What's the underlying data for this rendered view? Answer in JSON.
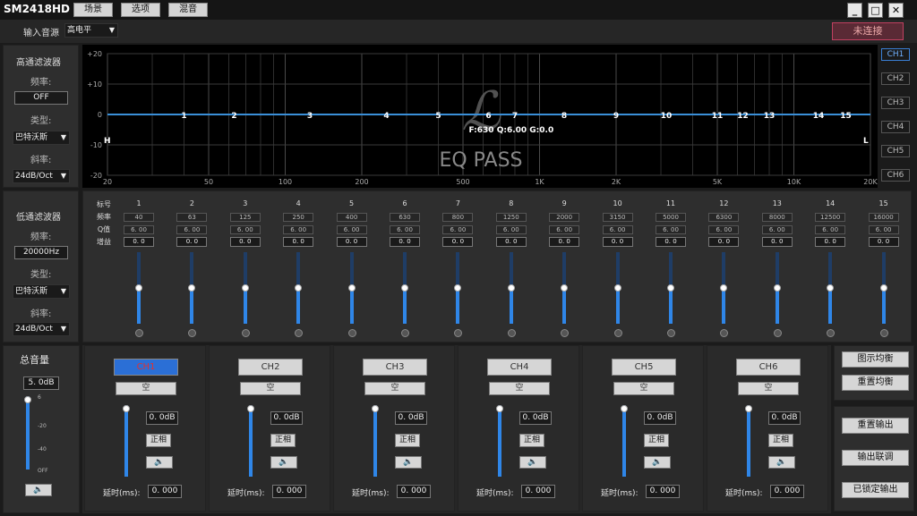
{
  "app": {
    "title": "SM2418HD",
    "menu": [
      "场景",
      "选项",
      "混音"
    ],
    "min_label": "_",
    "max_label": "□",
    "close_label": "✕"
  },
  "toolbar": {
    "input_source_label": "输入音源",
    "input_source_value": "高电平",
    "connect_label": "未连接"
  },
  "highpass": {
    "title": "高通滤波器",
    "freq_label": "频率:",
    "freq_value": "OFF",
    "type_label": "类型:",
    "type_value": "巴特沃斯",
    "slope_label": "斜率:",
    "slope_value": "24dB/Oct"
  },
  "lowpass": {
    "title": "低通滤波器",
    "freq_label": "频率:",
    "freq_value": "20000Hz",
    "type_label": "类型:",
    "type_value": "巴特沃斯",
    "slope_label": "斜率:",
    "slope_value": "24dB/Oct"
  },
  "graph": {
    "y_ticks": [
      "+20",
      "+10",
      "0",
      "-10",
      "-20"
    ],
    "x_ticks": [
      "20",
      "50",
      "100",
      "200",
      "500",
      "1K",
      "2K",
      "5K",
      "10K",
      "20K"
    ],
    "band_markers": [
      "1",
      "2",
      "3",
      "4",
      "5",
      "6",
      "7",
      "8",
      "9",
      "10",
      "11",
      "12",
      "13",
      "14",
      "15"
    ],
    "readout": "F:630 Q:6.00 G:0.0",
    "hp_marker": "H",
    "lp_marker": "L",
    "logo_text": "EQ PASS",
    "channels": [
      "CH1",
      "CH2",
      "CH3",
      "CH4",
      "CH5",
      "CH6"
    ],
    "line_color": "#3a8fd8"
  },
  "bands": {
    "row_labels": [
      "标号",
      "频率",
      "Q值",
      "增益"
    ],
    "items": [
      {
        "n": "1",
        "freq": "40",
        "q": "6. 00",
        "gain": "0. 0"
      },
      {
        "n": "2",
        "freq": "63",
        "q": "6. 00",
        "gain": "0. 0"
      },
      {
        "n": "3",
        "freq": "125",
        "q": "6. 00",
        "gain": "0. 0"
      },
      {
        "n": "4",
        "freq": "250",
        "q": "6. 00",
        "gain": "0. 0"
      },
      {
        "n": "5",
        "freq": "400",
        "q": "6. 00",
        "gain": "0. 0"
      },
      {
        "n": "6",
        "freq": "630",
        "q": "6. 00",
        "gain": "0. 0"
      },
      {
        "n": "7",
        "freq": "800",
        "q": "6. 00",
        "gain": "0. 0"
      },
      {
        "n": "8",
        "freq": "1250",
        "q": "6. 00",
        "gain": "0. 0"
      },
      {
        "n": "9",
        "freq": "2000",
        "q": "6. 00",
        "gain": "0. 0"
      },
      {
        "n": "10",
        "freq": "3150",
        "q": "6. 00",
        "gain": "0. 0"
      },
      {
        "n": "11",
        "freq": "5000",
        "q": "6. 00",
        "gain": "0. 0"
      },
      {
        "n": "12",
        "freq": "6300",
        "q": "6. 00",
        "gain": "0. 0"
      },
      {
        "n": "13",
        "freq": "8000",
        "q": "6. 00",
        "gain": "0. 0"
      },
      {
        "n": "14",
        "freq": "12500",
        "q": "6. 00",
        "gain": "0. 0"
      },
      {
        "n": "15",
        "freq": "16000",
        "q": "6. 00",
        "gain": "0. 0"
      }
    ],
    "slider_level": 0.6
  },
  "master": {
    "title": "总音量",
    "value": "5. 0dB",
    "ticks": [
      "6",
      "-20",
      "-40",
      "OFF"
    ],
    "level": 0.95,
    "mute_icon": "🔈"
  },
  "outputs": {
    "null_label": "空",
    "gain_value": "0. 0dB",
    "phase_label": "正相",
    "delay_label": "延时(ms):",
    "delay_value": "0. 000",
    "mute_icon": "🔈",
    "level": 0.95,
    "channels": [
      "CH1",
      "CH2",
      "CH3",
      "CH4",
      "CH5",
      "CH6"
    ]
  },
  "right_buttons": {
    "show_eq": "图示均衡",
    "reset_eq": "重置均衡",
    "reset_output": "重置输出",
    "link_output": "输出联调",
    "locked_output": "已锁定输出"
  }
}
